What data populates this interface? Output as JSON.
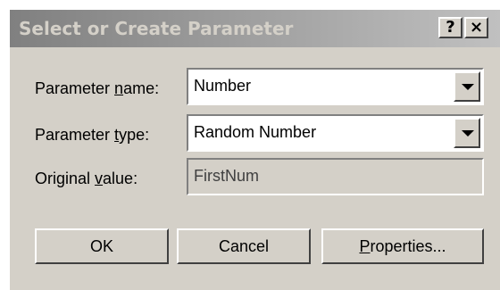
{
  "dialog": {
    "title": "Select or Create Parameter",
    "help_button": "?",
    "close_button": "×"
  },
  "fields": [
    {
      "label_pre": "Parameter ",
      "label_mn": "n",
      "label_post": "ame:",
      "value": "Number"
    },
    {
      "label_pre": "Parameter ",
      "label_mn": "t",
      "label_post": "ype:",
      "value": "Random Number"
    },
    {
      "label_pre": "Original ",
      "label_mn": "v",
      "label_post": "alue:",
      "value": "FirstNum"
    }
  ],
  "buttons": {
    "ok": "OK",
    "cancel": "Cancel",
    "properties_mn": "P",
    "properties_rest": "roperties..."
  }
}
